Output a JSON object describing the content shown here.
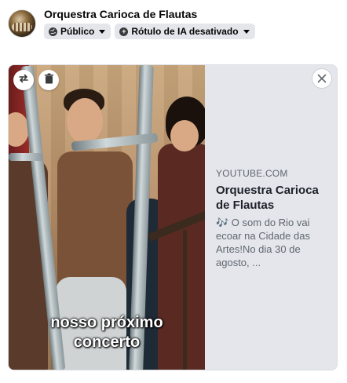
{
  "header": {
    "page_name": "Orquestra Carioca de Flautas",
    "audience_label": "Público",
    "ai_label": "Rótulo de IA desativado"
  },
  "link_preview": {
    "domain": "YOUTUBE.COM",
    "title": "Orquestra Carioca de Flautas",
    "description": "🎶 O som do Rio vai ecoar na Cidade das Artes!No dia 30 de agosto, ...",
    "thumbnail_caption_line1": "nosso próximo",
    "thumbnail_caption_line2": "concerto"
  },
  "icons": {
    "audience": "globe-icon",
    "ai_label": "plus-circle-icon",
    "swap": "swap-arrows-icon",
    "delete": "trash-icon",
    "close": "close-icon"
  },
  "colors": {
    "chip_bg": "#e4e6eb",
    "card_bg": "#e4e6eb",
    "muted_text": "#606770",
    "title_text": "#1d2129"
  }
}
